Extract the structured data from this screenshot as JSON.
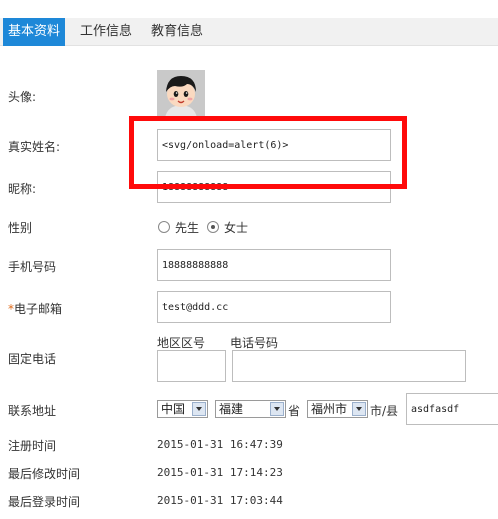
{
  "tabs": [
    {
      "label": "基本资料",
      "active": true
    },
    {
      "label": "工作信息",
      "active": false
    },
    {
      "label": "教育信息",
      "active": false
    }
  ],
  "labels": {
    "avatar": "头像:",
    "real_name": "真实姓名:",
    "nickname": "昵称:",
    "gender": "性别",
    "mobile": "手机号码",
    "email_required_mark": "*",
    "email": "电子邮箱",
    "phone": "固定电话",
    "area_code": "地区区号",
    "phone_number": "电话号码",
    "address": "联系地址",
    "province_suffix": "省",
    "city_suffix": "市/县",
    "register_time": "注册时间",
    "last_modified": "最后修改时间",
    "last_login": "最后登录时间"
  },
  "fields": {
    "real_name": "<svg/onload=alert(6)>",
    "nickname": "18888888888",
    "mobile": "18888888888",
    "email": "test@ddd.cc",
    "area_code": "",
    "phone_number": "",
    "address_detail": "asdfasdf"
  },
  "gender": {
    "options": [
      "先生",
      "女士"
    ],
    "selected": "女士"
  },
  "address_selects": {
    "country": "中国",
    "province": "福建",
    "city": "福州市"
  },
  "times": {
    "register": "2015-01-31 16:47:39",
    "modified": "2015-01-31 17:14:23",
    "login": "2015-01-31 17:03:44"
  },
  "colors": {
    "tab_active": "#1e88d8",
    "highlight_box": "#ff0a0a",
    "required_mark": "#e06b1c"
  },
  "icons": {
    "avatar": "cartoon-boy-avatar"
  }
}
